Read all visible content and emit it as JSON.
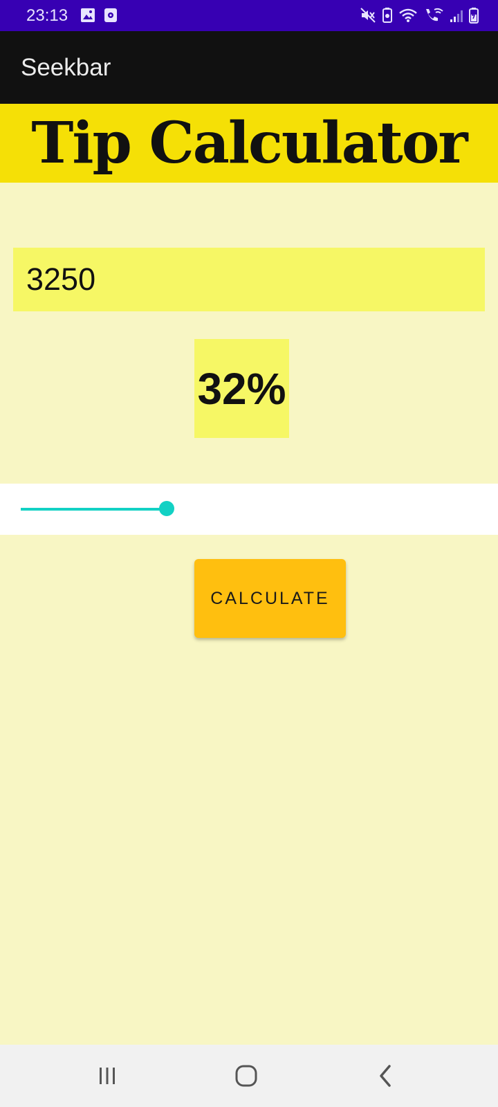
{
  "status_bar": {
    "time": "23:13",
    "left_icons": [
      "image-icon",
      "media-icon"
    ],
    "right_icons": [
      "mute-icon",
      "battery-saver-icon",
      "wifi-icon",
      "wifi-calling-icon",
      "signal-icon",
      "battery-icon"
    ]
  },
  "app_bar": {
    "title": "Seekbar"
  },
  "banner": {
    "heading": "Tip Calculator"
  },
  "amount_input": {
    "value": "3250"
  },
  "percent_display": {
    "text": "32%"
  },
  "seekbar": {
    "progress_fraction": 0.32,
    "color": "#12d1c4"
  },
  "calculate_button": {
    "label": "CALCULATE"
  },
  "nav_bar": {
    "buttons": [
      "recents-icon",
      "home-icon",
      "back-icon"
    ]
  },
  "colors": {
    "status_bar": "#3700b3",
    "app_bar": "#111111",
    "banner": "#f5e006",
    "background": "#f8f6c4",
    "input_bg": "#f6f765",
    "button": "#ffbf0f"
  }
}
